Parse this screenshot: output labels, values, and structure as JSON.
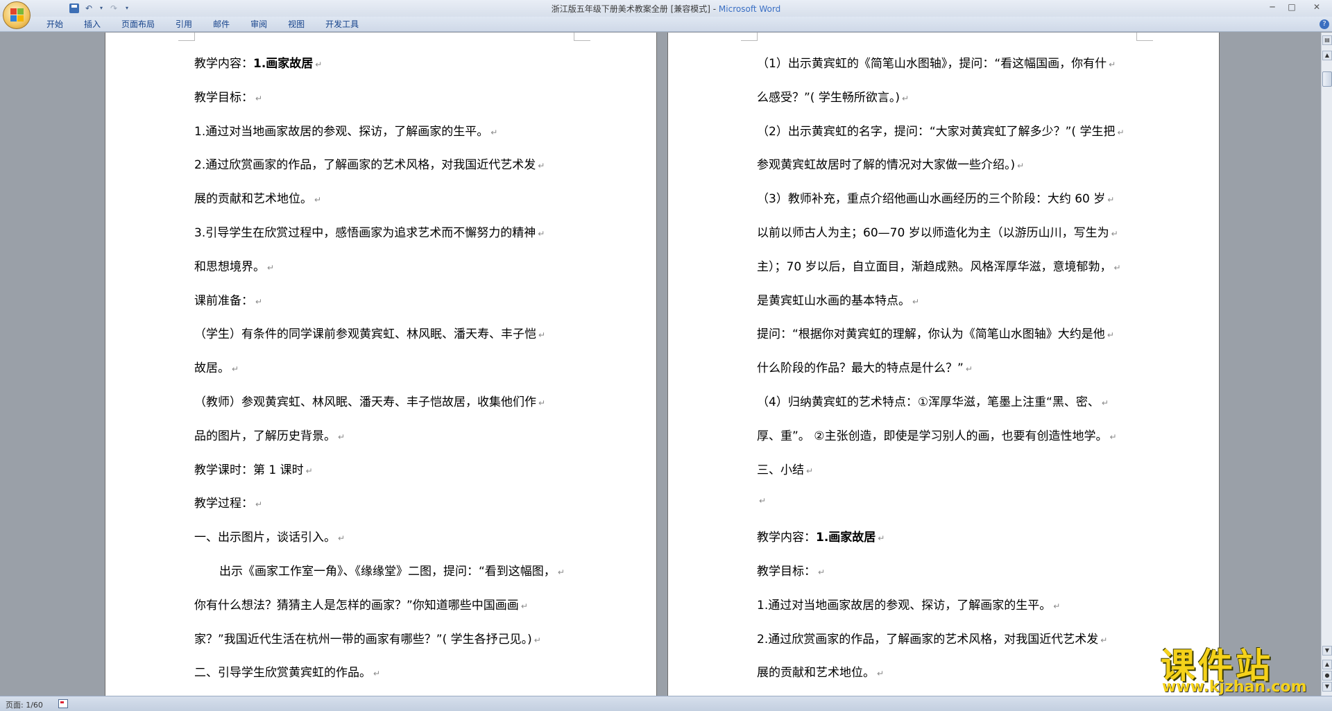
{
  "window": {
    "title": "浙江版五年级下册美术教案全册 [兼容模式] - ",
    "app_name": "Microsoft Word",
    "controls": [
      "─",
      "□",
      "✕"
    ]
  },
  "ribbon": {
    "tabs": [
      "开始",
      "插入",
      "页面布局",
      "引用",
      "邮件",
      "审阅",
      "视图",
      "开发工具"
    ],
    "help": "?"
  },
  "page_left": [
    {
      "prefix": "教学内容：",
      "bold": "1.画家故居"
    },
    {
      "text": "教学目标："
    },
    {
      "text": "1.通过对当地画家故居的参观、探访，了解画家的生平。"
    },
    {
      "text": "2.通过欣赏画家的作品，了解画家的艺术风格，对我国近代艺术发"
    },
    {
      "text": "展的贡献和艺术地位。"
    },
    {
      "text": "3.引导学生在欣赏过程中，感悟画家为追求艺术而不懈努力的精神"
    },
    {
      "text": "和思想境界。"
    },
    {
      "text": "课前准备："
    },
    {
      "text": "（学生）有条件的同学课前参观黄宾虹、林风眠、潘天寿、丰子恺"
    },
    {
      "text": "故居。"
    },
    {
      "text": "（教师）参观黄宾虹、林风眠、潘天寿、丰子恺故居，收集他们作"
    },
    {
      "text": "品的图片，了解历史背景。"
    },
    {
      "text": "教学课时：第 1 课时"
    },
    {
      "text": "教学过程："
    },
    {
      "text": "一、出示图片，谈话引入。"
    },
    {
      "text": "出示《画家工作室一角》、《缘缘堂》二图，提问：“看到这幅图，",
      "indent": true
    },
    {
      "text": "你有什么想法？猜猜主人是怎样的画家？”你知道哪些中国画画"
    },
    {
      "text": "家？”我国近代生活在杭州一带的画家有哪些？”( 学生各抒己见。)"
    },
    {
      "text": "二、引导学生欣赏黄宾虹的作品。"
    }
  ],
  "page_right": [
    {
      "text": "（1）出示黄宾虹的《简笔山水图轴》，提问：“看这幅国画，你有什"
    },
    {
      "text": "么感受？”( 学生畅所欲言。)"
    },
    {
      "text": "（2）出示黄宾虹的名字，提问：“大家对黄宾虹了解多少？”( 学生把"
    },
    {
      "text": "参观黄宾虹故居时了解的情况对大家做一些介绍。)"
    },
    {
      "text": "（3）教师补充，重点介绍他画山水画经历的三个阶段：大约 60 岁"
    },
    {
      "text": "以前以师古人为主；60—70 岁以师造化为主（以游历山川，写生为"
    },
    {
      "text": "主）；70 岁以后，自立面目，渐趋成熟。风格浑厚华滋，意境郁勃，"
    },
    {
      "text": "是黄宾虹山水画的基本特点。"
    },
    {
      "text": "提问：“根据你对黄宾虹的理解，你认为《简笔山水图轴》大约是他"
    },
    {
      "text": "什么阶段的作品？最大的特点是什么？”"
    },
    {
      "text": "（4）归纳黄宾虹的艺术特点：①浑厚华滋，笔墨上注重“黑、密、"
    },
    {
      "text": "厚、重”。 ②主张创造，即使是学习别人的画，也要有创造性地学。"
    },
    {
      "text": "三、小结"
    },
    {
      "text": ""
    },
    {
      "prefix": "教学内容：",
      "bold": "1.画家故居"
    },
    {
      "text": "教学目标："
    },
    {
      "text": "1.通过对当地画家故居的参观、探访，了解画家的生平。"
    },
    {
      "text": "2.通过欣赏画家的作品，了解画家的艺术风格，对我国近代艺术发"
    },
    {
      "text": "展的贡献和艺术地位。"
    }
  ],
  "paragraph_mark": "↵",
  "status": {
    "page_indicator": "页面: 1/60"
  },
  "watermark": {
    "name": "课件站",
    "url": "www.kjzhan.com"
  },
  "colors": {
    "ribbon_tab_text": "#15428b",
    "title_app": "#3a6fc4",
    "watermark": "#f5d21a"
  }
}
